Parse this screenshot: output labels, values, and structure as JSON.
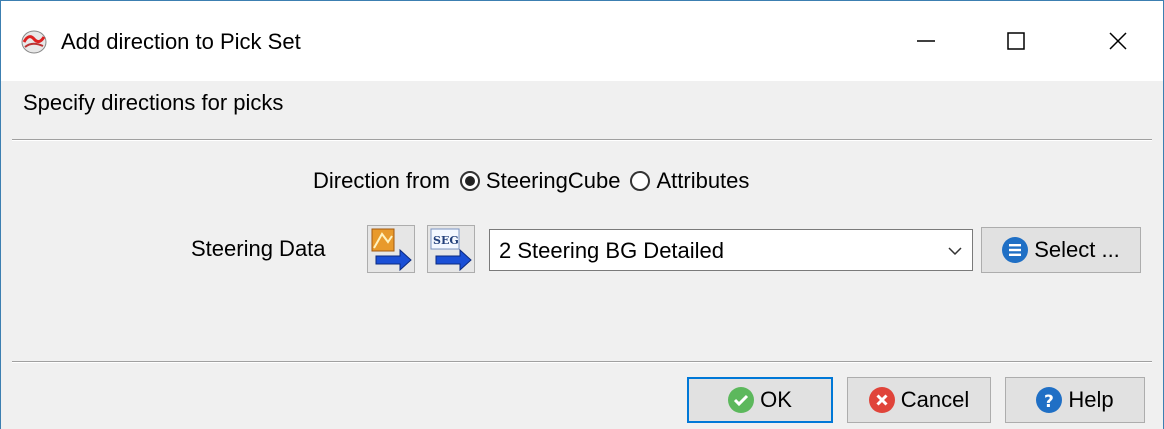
{
  "window": {
    "title": "Add direction to Pick Set"
  },
  "heading": "Specify directions for picks",
  "direction": {
    "label": "Direction from",
    "options": [
      {
        "label": "SteeringCube",
        "checked": true
      },
      {
        "label": "Attributes",
        "checked": false
      }
    ]
  },
  "steering": {
    "label": "Steering Data",
    "import_icon": "import-arrow-icon",
    "seg_icon": "seg-import-icon",
    "selected_value": "2 Steering BG Detailed",
    "select_button": "Select ..."
  },
  "footer": {
    "ok": "OK",
    "cancel": "Cancel",
    "help": "Help"
  },
  "colors": {
    "accent": "#0078d7",
    "ok_green": "#5cb85c",
    "cancel_red": "#e0443a",
    "help_blue": "#1f6fc5",
    "arrow_blue": "#1a4fd6"
  }
}
